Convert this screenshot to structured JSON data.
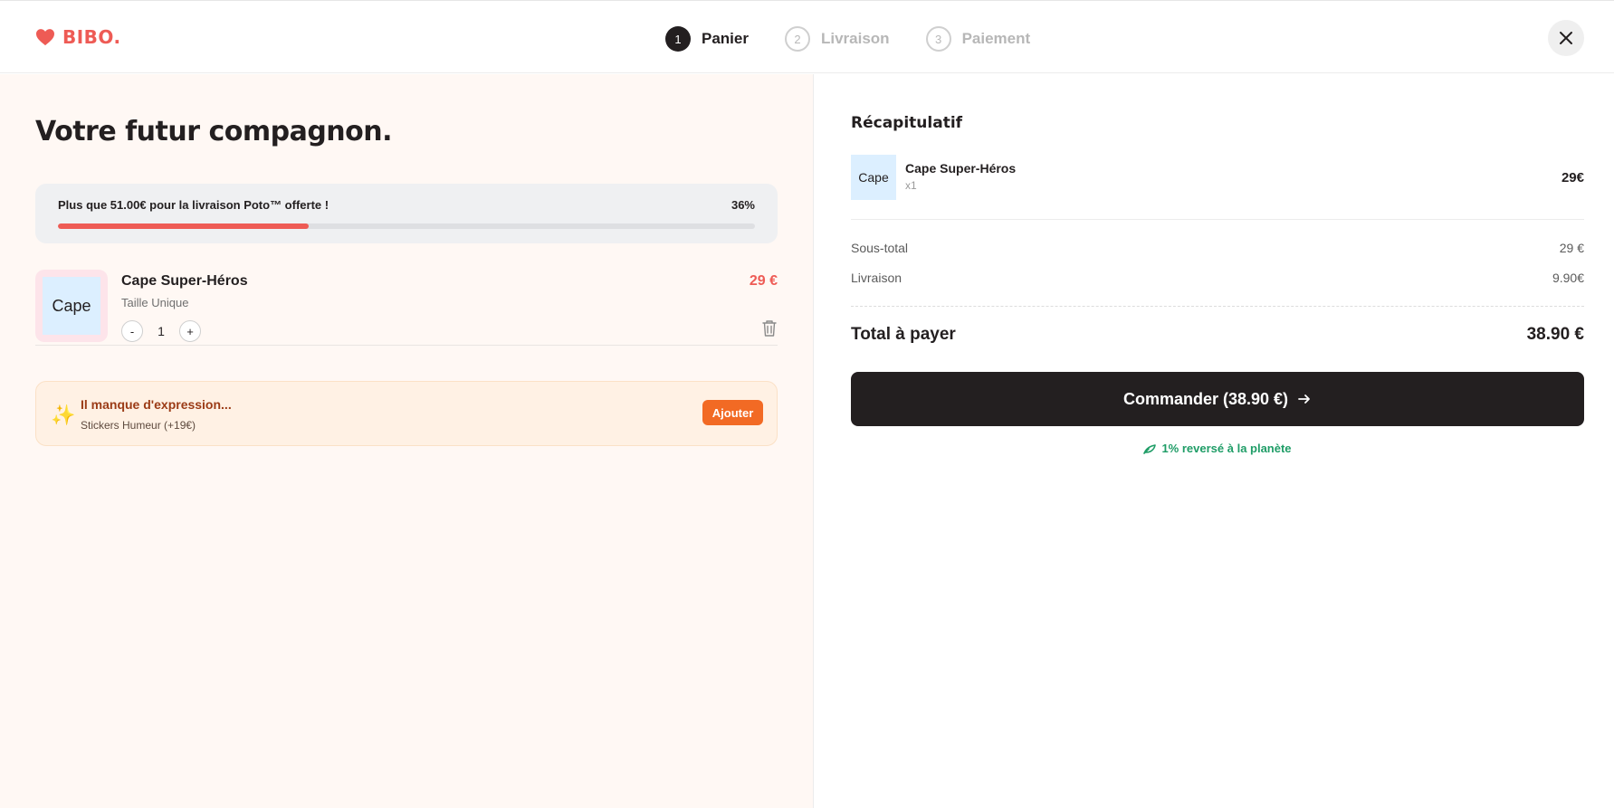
{
  "brand": {
    "name": "BIBO.",
    "color": "#ee5b55"
  },
  "steps": [
    {
      "number": "1",
      "label": "Panier",
      "state": "active"
    },
    {
      "number": "2",
      "label": "Livraison",
      "state": "inactive"
    },
    {
      "number": "3",
      "label": "Paiement",
      "state": "inactive"
    }
  ],
  "cart": {
    "title": "Votre futur compagnon.",
    "shipping": {
      "message": "Plus que 51.00€ pour la livraison Poto™ offerte !",
      "percent_label": "36%",
      "progress": 0.36
    },
    "item": {
      "thumb_label": "Cape",
      "name": "Cape Super-Héros",
      "variant": "Taille Unique",
      "quantity": "1",
      "minus_label": "-",
      "plus_label": "+",
      "price": "29 €"
    },
    "upsell": {
      "title": "Il manque d'expression...",
      "subtitle": "Stickers Humeur (+19€)",
      "button": "Ajouter"
    }
  },
  "summary": {
    "title": "Récapitulatif",
    "item": {
      "thumb_label": "Cape",
      "name": "Cape Super-Héros",
      "quantity": "x1",
      "price": "29€"
    },
    "subtotal_label": "Sous-total",
    "subtotal_value": "29 €",
    "shipping_label": "Livraison",
    "shipping_value": "9.90€",
    "total_label": "Total à payer",
    "total_value": "38.90 €",
    "cta_label": "Commander (38.90 €)",
    "eco_note": "1% reversé à la planète"
  },
  "colors": {
    "accent": "#ee5b55",
    "dark": "#231f20",
    "orange": "#f26a24",
    "green": "#1f9d67",
    "left_bg": "#fff8f4"
  },
  "icons": {
    "logo": "heart-icon",
    "close": "close-icon",
    "trash": "trash-icon",
    "upsell": "sparkles-icon",
    "cta": "arrow-right-icon",
    "eco": "leaf-icon"
  }
}
